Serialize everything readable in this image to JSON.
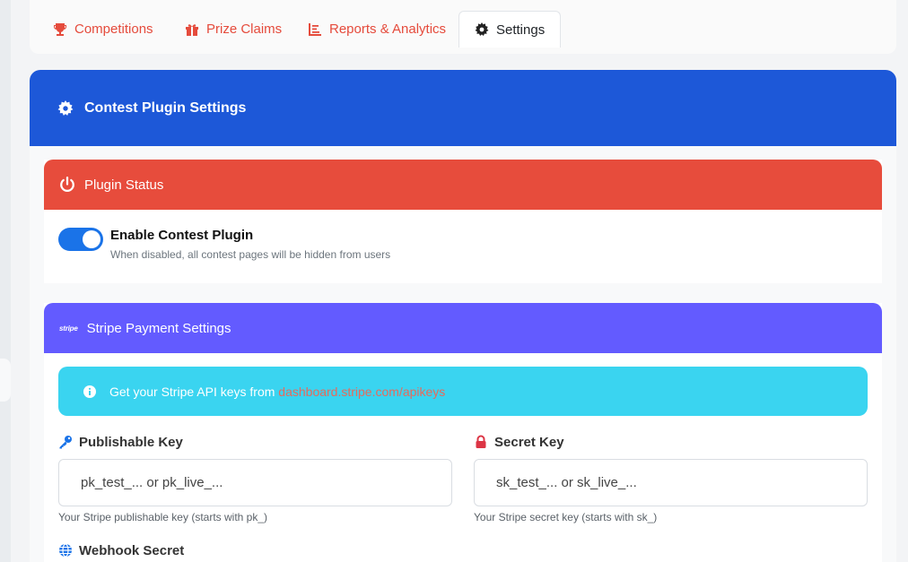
{
  "tabs": [
    {
      "label": "Competitions",
      "icon": "trophy-icon",
      "active": false
    },
    {
      "label": "Prize Claims",
      "icon": "gift-icon",
      "active": false
    },
    {
      "label": "Reports & Analytics",
      "icon": "chart-icon",
      "active": false
    },
    {
      "label": "Settings",
      "icon": "gear-icon",
      "active": true
    }
  ],
  "header": {
    "title": "Contest Plugin Settings",
    "color": "#1d58d8"
  },
  "plugin_status": {
    "title": "Plugin Status",
    "color": "#e74c3c",
    "toggle_label": "Enable Contest Plugin",
    "toggle_help": "When disabled, all contest pages will be hidden from users",
    "enabled": true
  },
  "stripe": {
    "title": "Stripe Payment Settings",
    "logo_text": "stripe",
    "color": "#635bff",
    "info_prefix": "Get your Stripe API keys from ",
    "info_link": "dashboard.stripe.com/apikeys",
    "publishable": {
      "label": "Publishable Key",
      "placeholder": "pk_test_... or pk_live_...",
      "help": "Your Stripe publishable key (starts with pk_)"
    },
    "secret": {
      "label": "Secret Key",
      "placeholder": "sk_test_... or sk_live_...",
      "help": "Your Stripe secret key (starts with sk_)"
    },
    "webhook": {
      "label": "Webhook Secret"
    }
  }
}
